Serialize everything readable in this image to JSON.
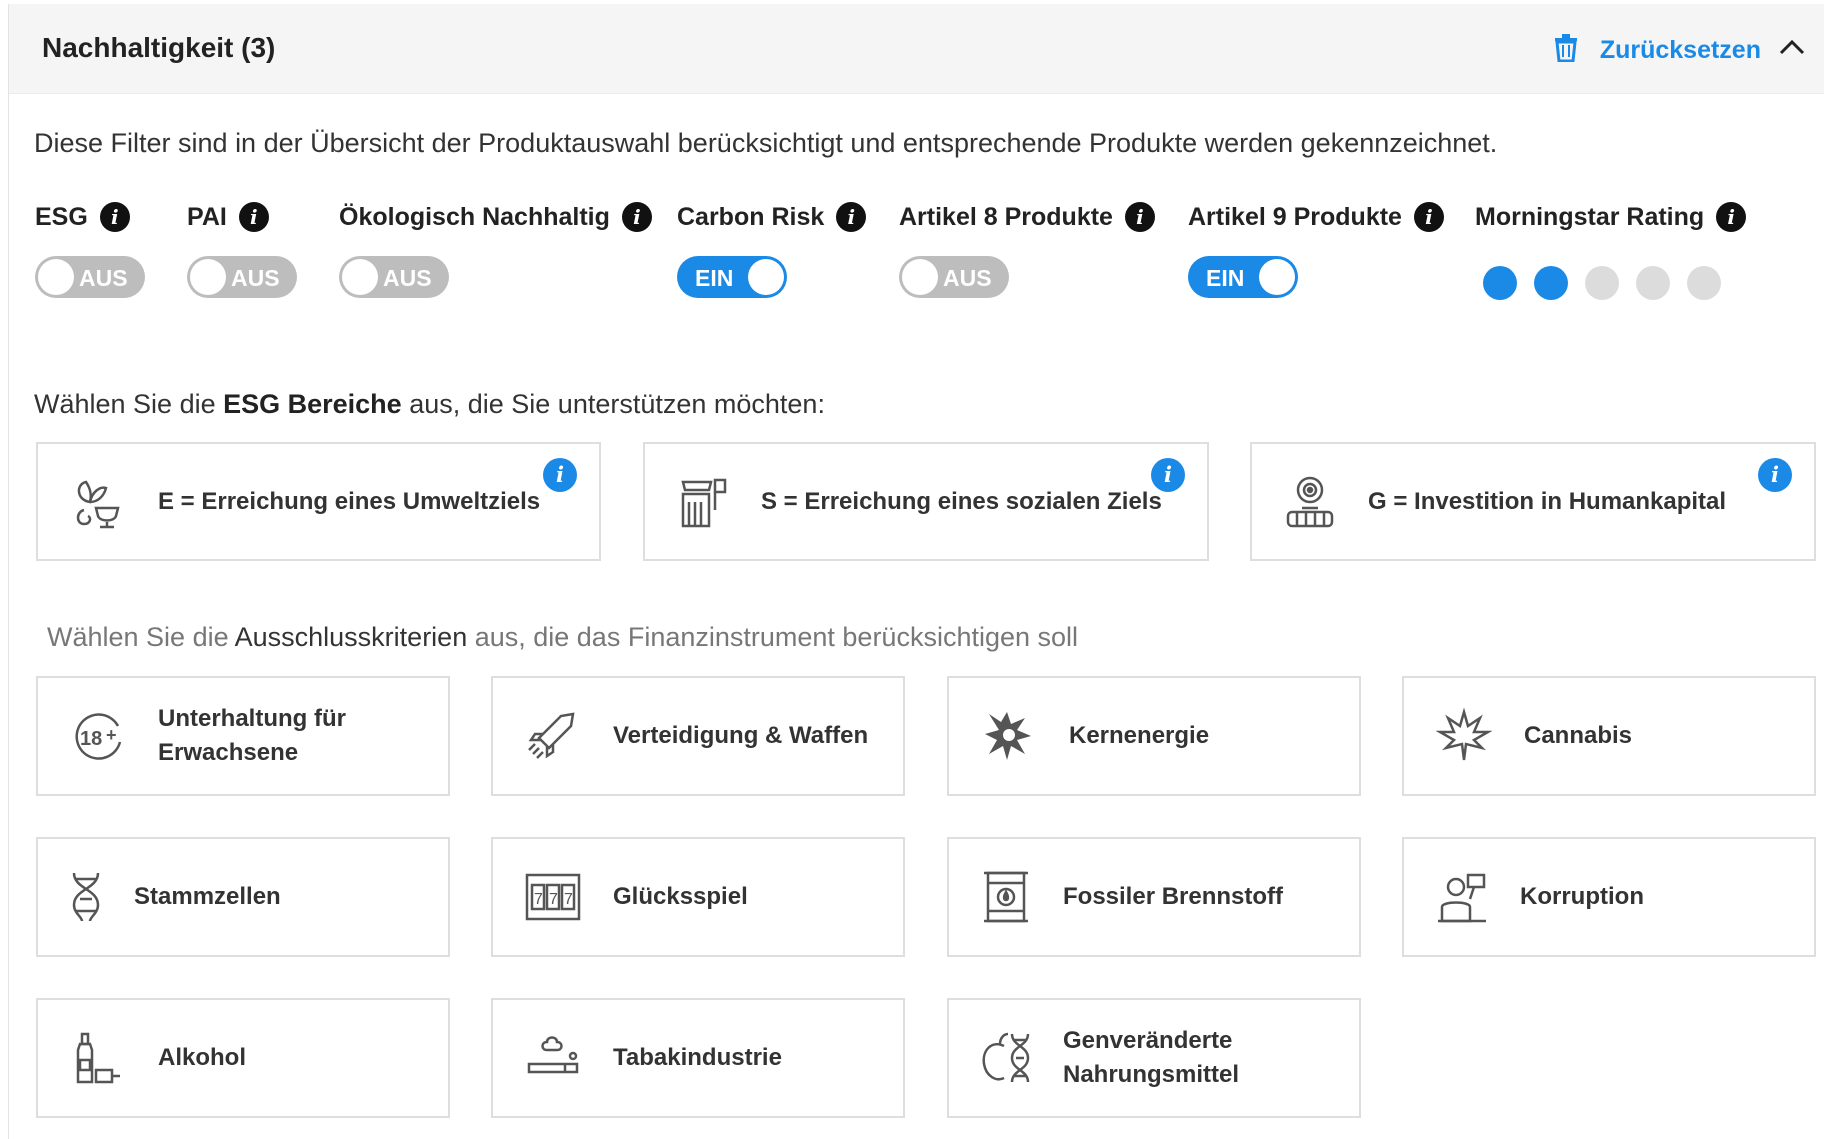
{
  "header": {
    "title": "Nachhaltigkeit (3)",
    "reset_label": "Zurücksetzen"
  },
  "intro": "Diese Filter sind in der Übersicht der Produktauswahl berücksichtigt und entsprechende Produkte werden gekennzeichnet.",
  "filters": [
    {
      "label": "ESG",
      "state": "AUS",
      "on": false
    },
    {
      "label": "PAI",
      "state": "AUS",
      "on": false
    },
    {
      "label": "Ökologisch Nachhaltig",
      "state": "AUS",
      "on": false
    },
    {
      "label": "Carbon Risk",
      "state": "EIN",
      "on": true
    },
    {
      "label": "Artikel 8 Produkte",
      "state": "AUS",
      "on": false
    },
    {
      "label": "Artikel 9 Produkte",
      "state": "EIN",
      "on": true
    }
  ],
  "morningstar": {
    "label": "Morningstar Rating",
    "rating": 2,
    "max": 5
  },
  "esg_section": {
    "prefix": "Wählen Sie die ",
    "bold": "ESG Bereiche",
    "suffix": " aus, die Sie unterstützen möchten:"
  },
  "esg_areas": [
    {
      "label": "E = Erreichung eines Umweltziels",
      "icon": "plant-trophy-icon"
    },
    {
      "label": "S = Erreichung eines sozialen Ziels",
      "icon": "factory-icon"
    },
    {
      "label": "G = Investition in Humankapital",
      "icon": "people-target-icon"
    }
  ],
  "exclusion_section": {
    "prefix": "Wählen Sie die ",
    "emphasis": "Ausschlusskriterien",
    "suffix": " aus, die das Finanzinstrument berücksichtigen soll"
  },
  "exclusions": [
    {
      "label1": "Unterhaltung für",
      "label2": "Erwachsene",
      "icon": "adult-18-icon"
    },
    {
      "label1": "Verteidigung & Waffen",
      "label2": "",
      "icon": "rocket-icon"
    },
    {
      "label1": "Kernenergie",
      "label2": "",
      "icon": "explosion-icon"
    },
    {
      "label1": "Cannabis",
      "label2": "",
      "icon": "cannabis-leaf-icon"
    },
    {
      "label1": "Stammzellen",
      "label2": "",
      "icon": "dna-icon"
    },
    {
      "label1": "Glücksspiel",
      "label2": "",
      "icon": "slot-machine-icon"
    },
    {
      "label1": "Fossiler Brennstoff",
      "label2": "",
      "icon": "oil-barrel-icon"
    },
    {
      "label1": "Korruption",
      "label2": "",
      "icon": "bribe-icon"
    },
    {
      "label1": "Alkohol",
      "label2": "",
      "icon": "bottle-icon"
    },
    {
      "label1": "Tabakindustrie",
      "label2": "",
      "icon": "cigarette-icon"
    },
    {
      "label1": "Genveränderte",
      "label2": "Nahrungsmittel",
      "icon": "gmo-apple-icon"
    }
  ],
  "colors": {
    "accent": "#1b8ae6",
    "toggle_off": "#bdbdbd",
    "header_bg": "#f5f5f5"
  }
}
